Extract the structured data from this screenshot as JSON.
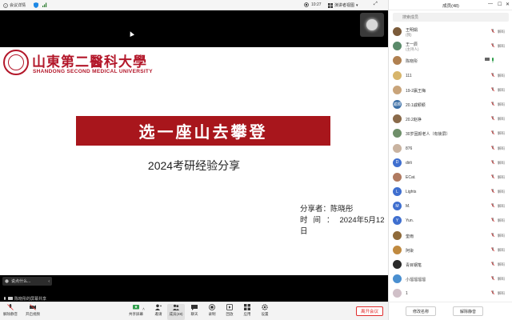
{
  "topbar": {
    "meeting_details": "会议详情",
    "time": "10:27",
    "view_label": "演讲者视图",
    "colors": {
      "shield": "#1e88e5",
      "signal": "#2e7d32"
    }
  },
  "slide": {
    "logo_cn": "山東第二醫科大學",
    "logo_en": "SHANDONG SECOND MEDICAL UNIVERSITY",
    "title": "选一座山去攀登",
    "subtitle": "2024考研经验分享",
    "presenter": "分享者：陈晓彤",
    "date_label": "时间：",
    "date_value": "2024年5月12日",
    "brand_color": "#a8161c"
  },
  "caption": {
    "text": "说点什么..."
  },
  "share_notice": "陈晓彤的屏幕共享",
  "toolbar": {
    "unmute": "解除静音",
    "start_video": "开启视频",
    "share": "共享屏幕",
    "invite": "邀请",
    "members": "成员(48)",
    "chat": "聊天",
    "record": "录制",
    "apps": "应用",
    "more": "设置",
    "view": "回放",
    "leave": "离开会议"
  },
  "panel": {
    "title": "成员(48)",
    "search_placeholder": "搜索成员",
    "participants": [
      {
        "name": "王明娟",
        "sub": "(我)",
        "color": "#7b5b3a",
        "initial": "",
        "mute": "解码"
      },
      {
        "name": "王一辰",
        "sub": "(主持人)",
        "color": "#5a8a6a",
        "initial": "",
        "mute": "解码"
      },
      {
        "name": "陈晓彤",
        "sub": "",
        "color": "#b08050",
        "initial": "",
        "mute": "",
        "sharing": true
      },
      {
        "name": "111",
        "sub": "",
        "color": "#d7b56b",
        "initial": "",
        "mute": "解码"
      },
      {
        "name": "19-2嬴王梅",
        "sub": "",
        "color": "#c9a47a",
        "initial": "",
        "mute": "解码"
      },
      {
        "name": "20.1戚颖颖",
        "sub": "",
        "color": "#3a6ea5",
        "initial": "戚颖",
        "mute": "解码"
      },
      {
        "name": "20.2赵铮",
        "sub": "",
        "color": "#8a6a4a",
        "initial": "",
        "mute": "解码"
      },
      {
        "name": "30岁固颜老人（有锁屏）",
        "sub": "",
        "color": "#6f8f6a",
        "initial": "",
        "mute": "解码"
      },
      {
        "name": "876",
        "sub": "",
        "color": "#c9b3a0",
        "initial": "",
        "mute": "解码"
      },
      {
        "name": "dirli",
        "sub": "",
        "color": "#3f6fcf",
        "initial": "D",
        "mute": "解码"
      },
      {
        "name": "ECat.",
        "sub": "",
        "color": "#b07a60",
        "initial": "",
        "mute": "解码"
      },
      {
        "name": "Lights",
        "sub": "",
        "color": "#3f6fcf",
        "initial": "L",
        "mute": "解码"
      },
      {
        "name": "M.",
        "sub": "",
        "color": "#3f6fcf",
        "initial": "M",
        "mute": "解码"
      },
      {
        "name": "Yun.",
        "sub": "",
        "color": "#3f6fcf",
        "initial": "Y",
        "mute": "解码"
      },
      {
        "name": "奎雨",
        "sub": "",
        "color": "#8f6a3a",
        "initial": "",
        "mute": "解码"
      },
      {
        "name": "阿柒",
        "sub": "",
        "color": "#c08a40",
        "initial": "",
        "mute": "解码"
      },
      {
        "name": "青目钢笔",
        "sub": "",
        "color": "#2a2a2a",
        "initial": "",
        "mute": "解码"
      },
      {
        "name": "小溜溜溜溜",
        "sub": "",
        "color": "#4a8fd0",
        "initial": "",
        "mute": "解码"
      },
      {
        "name": "1",
        "sub": "",
        "color": "#d0c0c8",
        "initial": "",
        "mute": "解码"
      }
    ],
    "footer": {
      "rename": "修改名称",
      "unmute": "解除静音"
    }
  }
}
